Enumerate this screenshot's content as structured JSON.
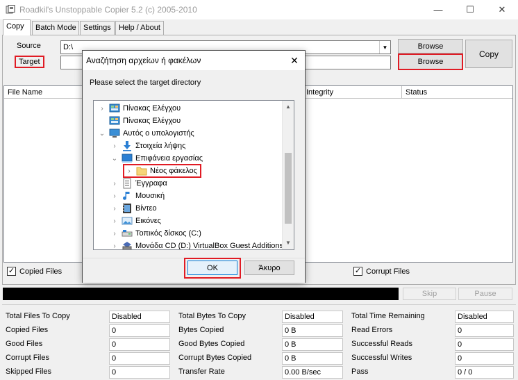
{
  "window": {
    "title": "Roadkil's Unstoppable Copier 5.2 (c) 2005-2010",
    "minimize": "—",
    "maximize": "☐",
    "close": "✕"
  },
  "tabs": [
    {
      "label": "Copy"
    },
    {
      "label": "Batch Mode"
    },
    {
      "label": "Settings"
    },
    {
      "label": "Help / About"
    }
  ],
  "source": {
    "label": "Source",
    "value": "D:\\",
    "browse": "Browse"
  },
  "target": {
    "label": "Target",
    "value": "",
    "browse": "Browse"
  },
  "copy_button": "Copy",
  "file_list": {
    "columns": [
      "File Name",
      "Integrity",
      "Status"
    ]
  },
  "options": {
    "copied_files": {
      "label": "Copied Files",
      "checked": "✓"
    },
    "corrupt_files": {
      "label": "Corrupt Files",
      "checked": "✓"
    }
  },
  "controls": {
    "skip": "Skip",
    "pause": "Pause"
  },
  "stats": {
    "col1": [
      {
        "k": "Total Files To Copy",
        "v": "Disabled"
      },
      {
        "k": "Copied Files",
        "v": "0"
      },
      {
        "k": "Good Files",
        "v": "0"
      },
      {
        "k": "Corrupt Files",
        "v": "0"
      },
      {
        "k": "Skipped Files",
        "v": "0"
      }
    ],
    "col2": [
      {
        "k": "Total Bytes To Copy",
        "v": "Disabled"
      },
      {
        "k": "Bytes Copied",
        "v": "0 B"
      },
      {
        "k": "Good Bytes Copied",
        "v": "0 B"
      },
      {
        "k": "Corrupt Bytes Copied",
        "v": "0 B"
      },
      {
        "k": "Transfer Rate",
        "v": "0.00 B/sec"
      }
    ],
    "col3": [
      {
        "k": "Total Time Remaining",
        "v": "Disabled"
      },
      {
        "k": "Read Errors",
        "v": "0"
      },
      {
        "k": "Successful Reads",
        "v": "0"
      },
      {
        "k": "Successful Writes",
        "v": "0"
      },
      {
        "k": "Pass",
        "v": "0 / 0"
      }
    ]
  },
  "dialog": {
    "title": "Αναζήτηση αρχείων ή φακέλων",
    "close": "✕",
    "prompt": "Please select the target directory",
    "tree": [
      {
        "label": "Πίνακας Ελέγχου",
        "icon": "control-panel-icon",
        "expander": "›"
      },
      {
        "label": "Πίνακας Ελέγχου",
        "icon": "control-panel-icon",
        "expander": ""
      },
      {
        "label": "Αυτός ο υπολογιστής",
        "icon": "computer-icon",
        "expander": "⌄"
      },
      {
        "label": "Στοιχεία λήψης",
        "icon": "downloads-icon",
        "expander": "›"
      },
      {
        "label": "Επιφάνεια εργασίας",
        "icon": "desktop-icon",
        "expander": "⌄"
      },
      {
        "label": "Νέος φάκελος",
        "icon": "folder-icon",
        "expander": "›"
      },
      {
        "label": "Έγγραφα",
        "icon": "documents-icon",
        "expander": "›"
      },
      {
        "label": "Μουσική",
        "icon": "music-icon",
        "expander": "›"
      },
      {
        "label": "Βίντεο",
        "icon": "video-icon",
        "expander": "›"
      },
      {
        "label": "Εικόνες",
        "icon": "pictures-icon",
        "expander": "›"
      },
      {
        "label": "Τοπικός δίσκος (C:)",
        "icon": "drive-icon",
        "expander": "›"
      },
      {
        "label": "Μονάδα CD (D:) VirtualBox Guest Additions",
        "icon": "cd-drive-icon",
        "expander": "›"
      }
    ],
    "ok": "OK",
    "cancel": "Άκυρο"
  },
  "colors": {
    "highlight": "#e01b24",
    "ok_border": "#0078d7"
  }
}
